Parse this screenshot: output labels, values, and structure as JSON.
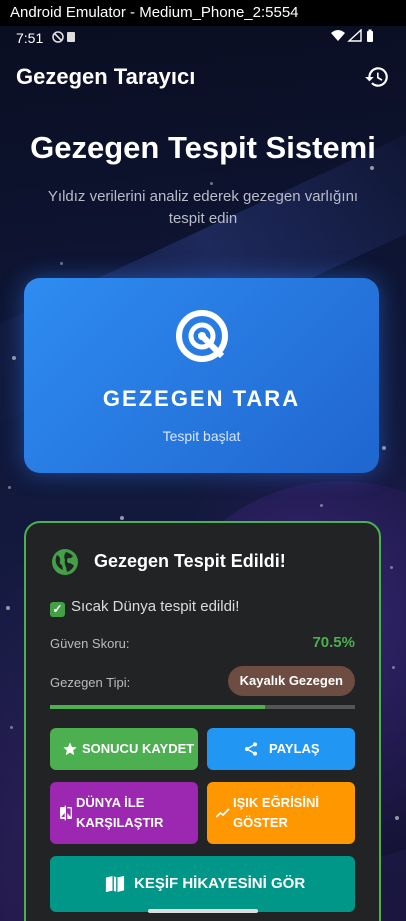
{
  "window": {
    "title": "Android Emulator - Medium_Phone_2:5554"
  },
  "status_bar": {
    "time": "7:51"
  },
  "app_bar": {
    "title": "Gezegen Tarayıcı",
    "action_icon": "history-icon"
  },
  "hero": {
    "title": "Gezegen Tespit Sistemi",
    "subtitle": "Yıldız verilerini analiz ederek gezegen varlığını tespit edin"
  },
  "scan_button": {
    "label": "GEZEGEN TARA",
    "sublabel": "Tespit başlat",
    "icon": "radar-icon"
  },
  "result": {
    "title": "Gezegen Tespit Edildi!",
    "description": "Sıcak Dünya tespit edildi!",
    "confidence_label": "Güven Skoru:",
    "confidence_value": "70.5%",
    "confidence_fraction": 0.705,
    "type_label": "Gezegen Tipi:",
    "type_value": "Kayalık Gezegen",
    "buttons": {
      "save": "SONUCU KAYDET",
      "share": "PAYLAŞ",
      "compare_line1": "DÜNYA İLE",
      "compare_line2": "KARŞILAŞTIR",
      "lightcurve_line1": "IŞIK EĞRİSİNİ",
      "lightcurve_line2": "GÖSTER",
      "story": "KEŞİF HİKAYESİNİ GÖR"
    }
  },
  "colors": {
    "accent_blue": "#2e8cf0",
    "success": "#4caf50",
    "save_button": "#4caf50",
    "share_button": "#2196f3",
    "compare_button": "#9c27b0",
    "lightcurve_button": "#ff9800",
    "story_button": "#009688",
    "type_chip": "#6d4c41"
  }
}
